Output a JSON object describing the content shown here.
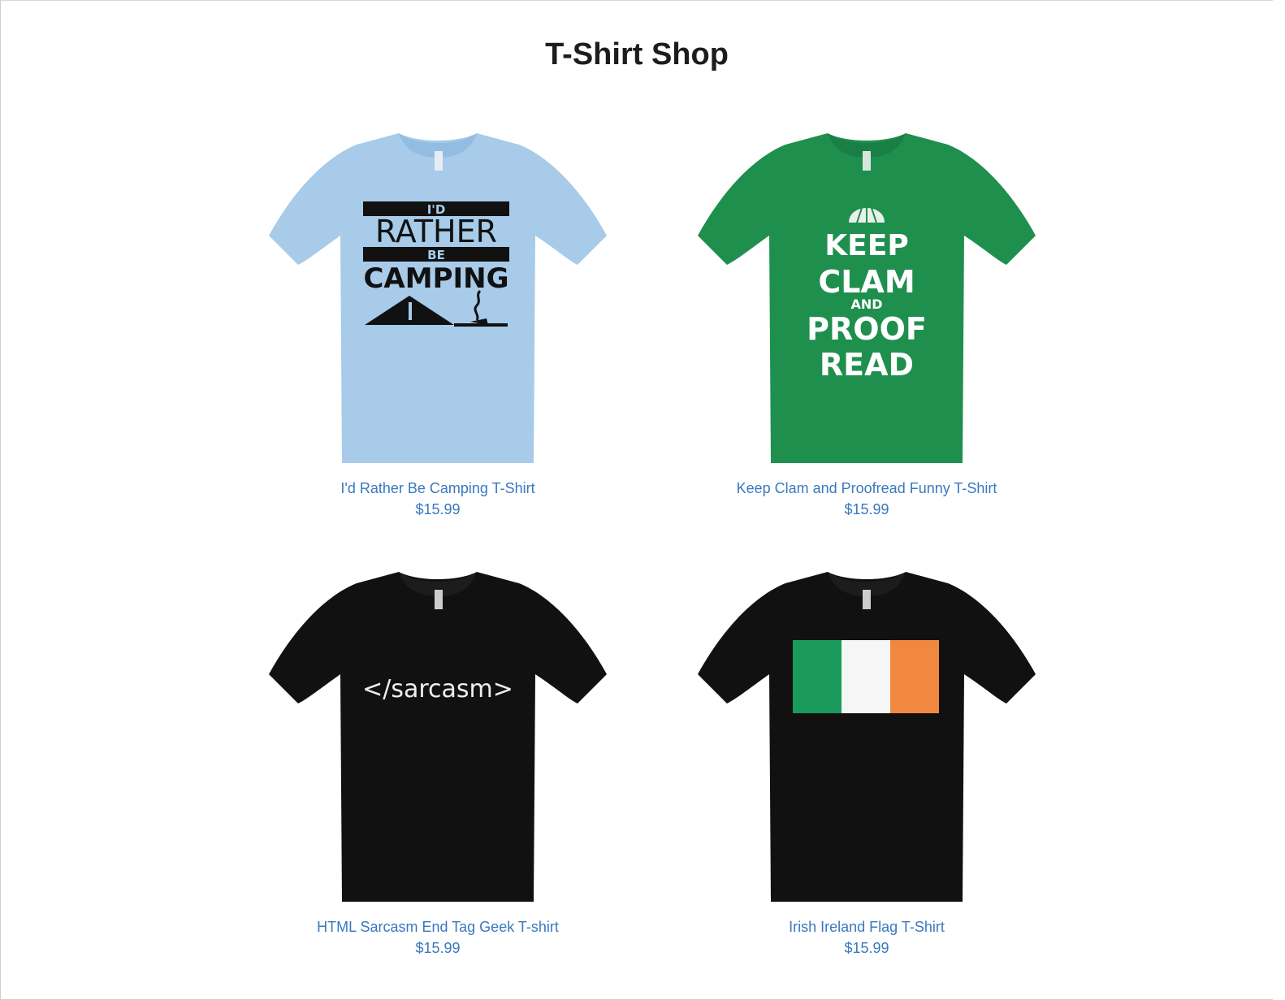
{
  "page": {
    "title": "T-Shirt Shop"
  },
  "colors": {
    "link": "#3a78bf",
    "shirt_light_blue": "#a7cbe8",
    "shirt_green": "#1f8f4e",
    "shirt_black": "#111111"
  },
  "products": [
    {
      "name": "I'd Rather Be Camping T-Shirt",
      "price": "$15.99",
      "shirt_color": "light-blue",
      "print": {
        "line1": "I'D",
        "line2": "RATHER",
        "line3": "BE",
        "line4": "CAMPING"
      }
    },
    {
      "name": "Keep Clam and Proofread Funny T-Shirt",
      "price": "$15.99",
      "shirt_color": "green",
      "print": {
        "line1": "KEEP",
        "line2": "CLAM",
        "line3": "AND",
        "line4": "PROOF",
        "line5": "READ"
      }
    },
    {
      "name": "HTML Sarcasm End Tag Geek T-shirt",
      "price": "$15.99",
      "shirt_color": "black",
      "print": {
        "line1": "</sarcasm>"
      }
    },
    {
      "name": "Irish Ireland Flag T-Shirt",
      "price": "$15.99",
      "shirt_color": "black",
      "print": {
        "flag_colors": [
          "#1a9b5c",
          "#f6f6f6",
          "#f0893f"
        ]
      }
    }
  ]
}
